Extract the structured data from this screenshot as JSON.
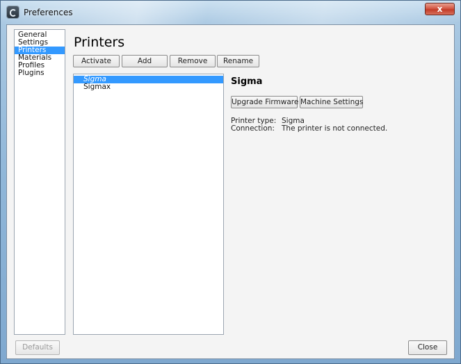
{
  "window": {
    "title": "Preferences",
    "close_glyph": "x",
    "icon": "app-logo-icon"
  },
  "sidebar": {
    "items": [
      {
        "label": "General",
        "active": false
      },
      {
        "label": "Settings",
        "active": false
      },
      {
        "label": "Printers",
        "active": true
      },
      {
        "label": "Materials",
        "active": false
      },
      {
        "label": "Profiles",
        "active": false
      },
      {
        "label": "Plugins",
        "active": false
      }
    ]
  },
  "page": {
    "title": "Printers",
    "toolbar": {
      "activate": "Activate",
      "add": "Add",
      "remove": "Remove",
      "rename": "Rename"
    }
  },
  "printers": {
    "items": [
      {
        "name": "Sigma",
        "selected": true
      },
      {
        "name": "Sigmax",
        "selected": false
      }
    ]
  },
  "details": {
    "name": "Sigma",
    "upgrade_firmware": "Upgrade Firmware",
    "machine_settings": "Machine Settings",
    "printer_type_label": "Printer type:",
    "printer_type_value": "Sigma",
    "connection_label": "Connection:",
    "connection_value": "The printer is not connected."
  },
  "footer": {
    "defaults": "Defaults",
    "close": "Close"
  },
  "colors": {
    "selection": "#3399ff",
    "close_button": "#c9432e"
  }
}
